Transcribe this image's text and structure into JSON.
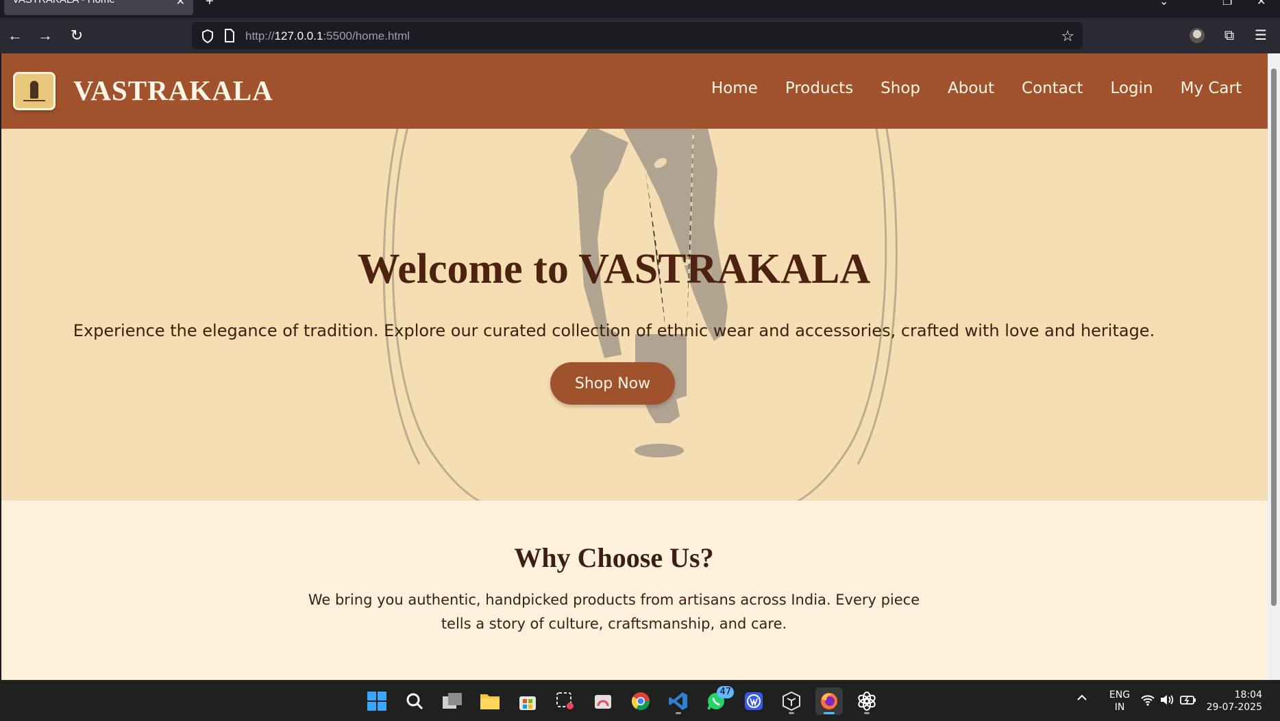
{
  "browser": {
    "tab_title": "VASTRAKALA - Home",
    "tab_close": "✕",
    "new_tab": "+",
    "url_prefix": "http://",
    "url_host": "127.0.0.1",
    "url_rest": ":5500/home.html"
  },
  "site": {
    "brand": "VASTRAKALA",
    "nav": [
      "Home",
      "Products",
      "Shop",
      "About",
      "Contact",
      "Login",
      "My Cart"
    ],
    "hero": {
      "title": "Welcome to VASTRAKALA",
      "subtitle": "Experience the elegance of tradition. Explore our curated collection of ethnic wear and accessories, crafted with love and heritage.",
      "cta": "Shop Now"
    },
    "why": {
      "title": "Why Choose Us?",
      "text": "We bring you authentic, handpicked products from artisans across India. Every piece tells a story of culture, craftsmanship, and care."
    },
    "colors": {
      "header": "#a0522d",
      "hero_bg": "#f5deb3",
      "section_bg": "#fdf1dd",
      "heading": "#4e2210"
    }
  },
  "taskbar": {
    "icons": [
      "windows-start-icon",
      "search-icon",
      "task-view-icon",
      "file-explorer-icon",
      "microsoft-store-icon",
      "snipping-tool-icon",
      "app-icon",
      "chrome-icon",
      "vscode-icon",
      "whatsapp-icon",
      "wordpress-icon",
      "app-cube-icon",
      "firefox-icon",
      "chatgpt-icon"
    ],
    "whatsapp_badge": "47",
    "lang_top": "ENG",
    "lang_bottom": "IN",
    "time": "18:04",
    "date": "29-07-2025"
  }
}
